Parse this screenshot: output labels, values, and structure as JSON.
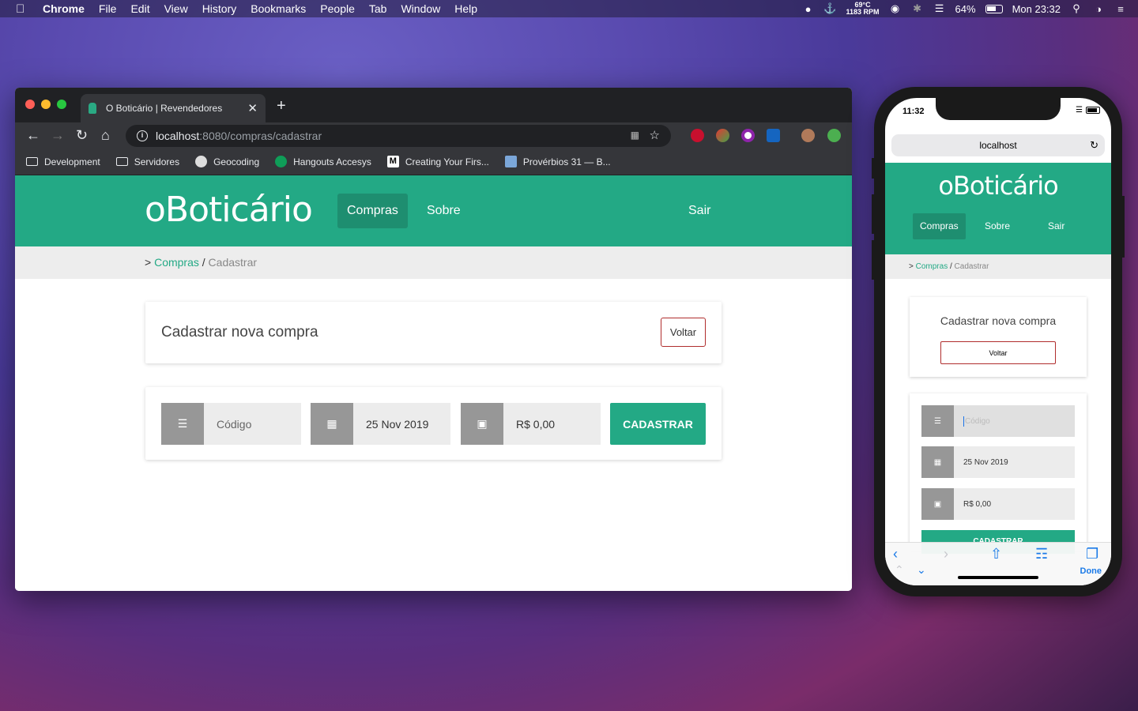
{
  "menubar": {
    "app": "Chrome",
    "items": [
      "File",
      "Edit",
      "View",
      "History",
      "Bookmarks",
      "People",
      "Tab",
      "Window",
      "Help"
    ],
    "temp": "69°C",
    "rpm": "1183 RPM",
    "battery": "64%",
    "clock": "Mon 23:32"
  },
  "browser": {
    "tab_title": "O Boticário | Revendedores",
    "url_host": "localhost",
    "url_path": ":8080/compras/cadastrar",
    "bookmarks": [
      "Development",
      "Servidores",
      "Geocoding",
      "Hangouts Accesys",
      "Creating Your Firs...",
      "Provérbios 31 — B..."
    ]
  },
  "site": {
    "logo": "oBoticário",
    "nav": {
      "compras": "Compras",
      "sobre": "Sobre",
      "sair": "Sair"
    },
    "breadcrumb": {
      "prefix": ">",
      "link": "Compras",
      "sep": "/",
      "current": "Cadastrar"
    },
    "form_title": "Cadastrar nova compra",
    "back_button": "Voltar",
    "fields": {
      "codigo_placeholder": "Código",
      "data_value": "25 Nov 2019",
      "valor_value": "R$ 0,00"
    },
    "submit_button": "CADASTRAR"
  },
  "phone": {
    "time": "11:32",
    "url": "localhost",
    "done": "Done",
    "submit_partial": "CADASTRAR"
  },
  "colors": {
    "brand_green": "#23a985",
    "brand_green_dark": "#1e8e70",
    "back_button_border": "#b02d2d"
  }
}
